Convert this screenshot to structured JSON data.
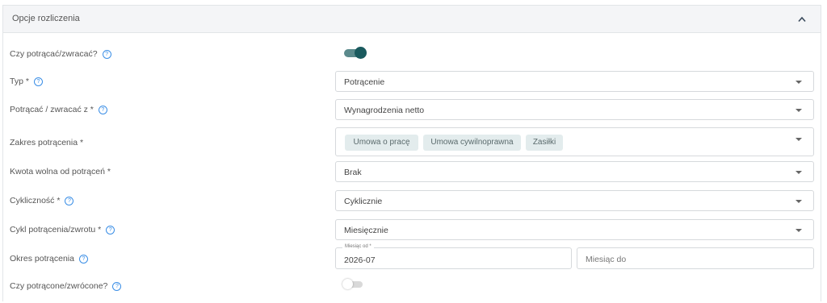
{
  "panel": {
    "title": "Opcje rozliczenia"
  },
  "help_glyph": "?",
  "rows": {
    "deduct": {
      "label": "Czy potrącać/zwracać?",
      "toggle_on": true
    },
    "type": {
      "label": "Typ *",
      "value": "Potrącenie"
    },
    "from": {
      "label": "Potrącać / zwracać z *",
      "value": "Wynagrodzenia netto"
    },
    "scope": {
      "label": "Zakres potrącenia *",
      "chips": [
        "Umowa o pracę",
        "Umowa cywilnoprawna",
        "Zasiłki"
      ]
    },
    "free_amount": {
      "label": "Kwota wolna od potrąceń *",
      "value": "Brak"
    },
    "cyclicity": {
      "label": "Cykliczność *",
      "value": "Cyklicznie"
    },
    "cycle": {
      "label": "Cykl potrącenia/zwrotu *",
      "value": "Miesięcznie"
    },
    "period": {
      "label": "Okres potrącenia",
      "from_label": "Miesiąc od *",
      "from_value": "2026-07",
      "to_placeholder": "Miesiąc do"
    },
    "deducted": {
      "label": "Czy potrącone/zwrócone?",
      "toggle_on": false
    }
  },
  "colors": {
    "accent": "#1a5a5e",
    "help": "#3a8ee6",
    "chip_bg": "#e3eced"
  }
}
